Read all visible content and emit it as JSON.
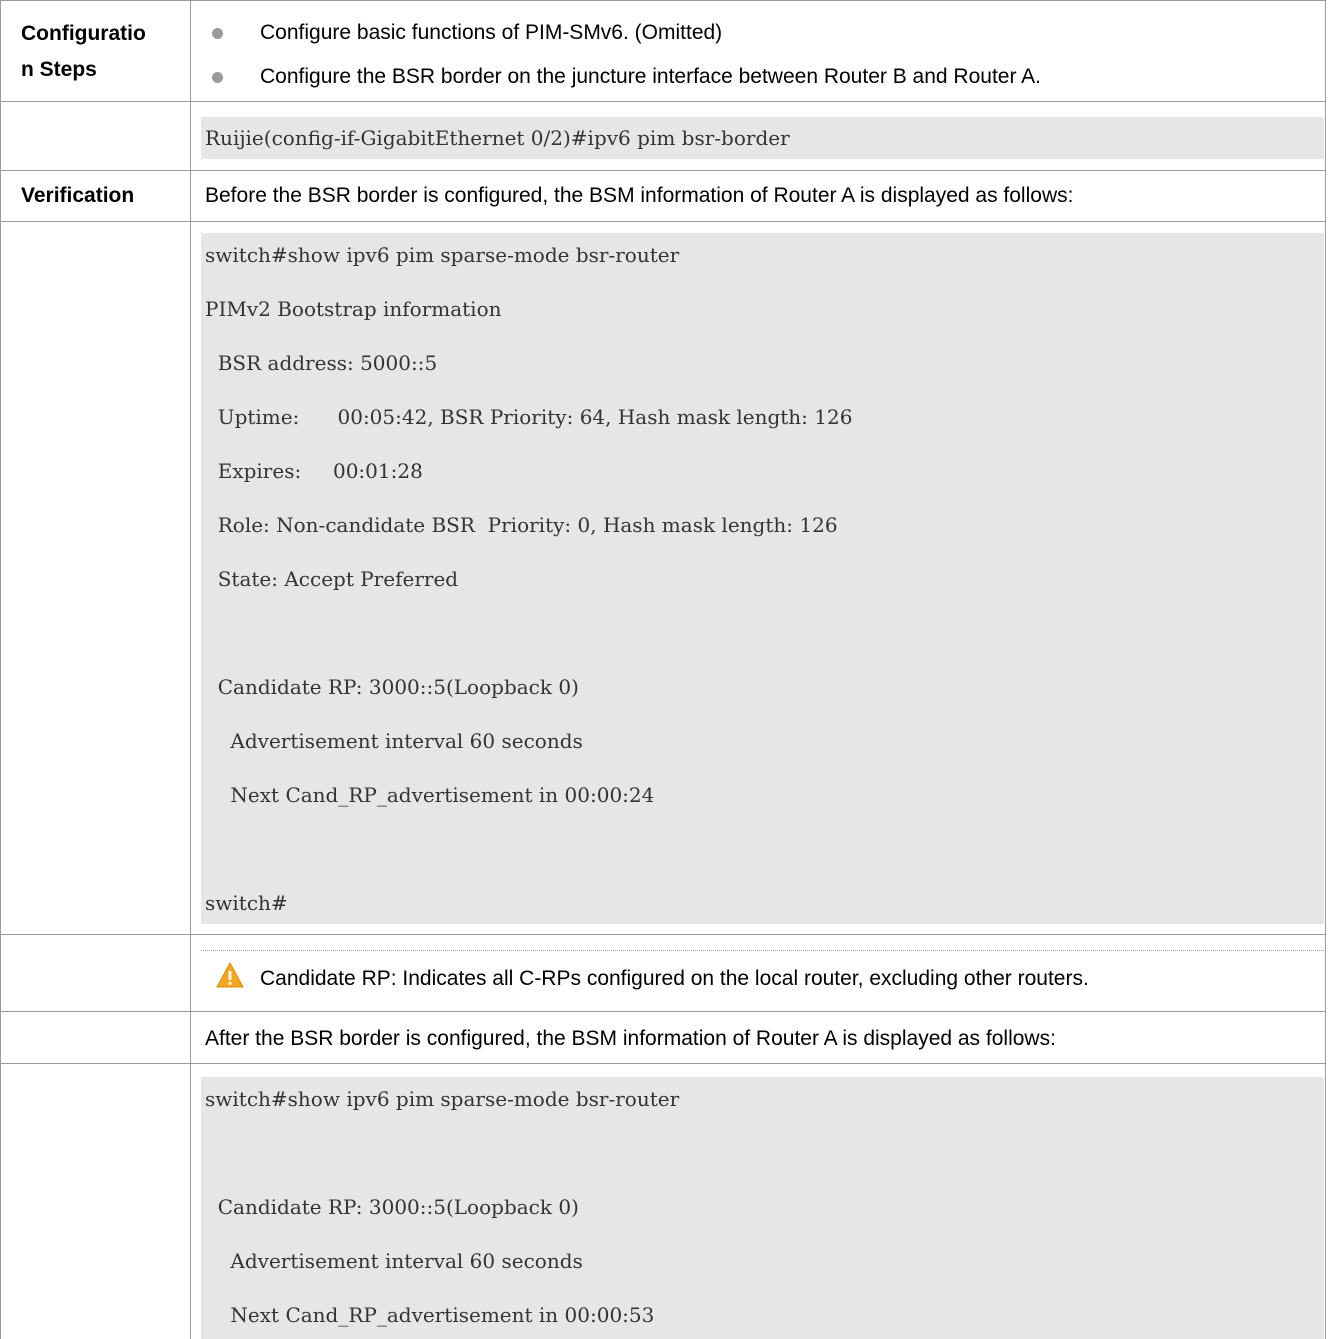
{
  "row1": {
    "label_line1": "Configuratio",
    "label_line2": "n Steps",
    "bullets": [
      "Configure basic functions of PIM-SMv6. (Omitted)",
      "Configure the BSR border on the juncture interface between Router B and Router A."
    ]
  },
  "row2": {
    "code": "Ruijie(config-if-GigabitEthernet 0/2)#ipv6 pim bsr-border"
  },
  "row3": {
    "label": "Verification",
    "text": "Before the BSR border is configured, the BSM information of Router A is displayed as follows:"
  },
  "code_block_1": {
    "lines": [
      "switch#show ipv6 pim sparse-mode bsr-router",
      "PIMv2 Bootstrap information",
      "  BSR address: 5000::5",
      "  Uptime:      00:05:42, BSR Priority: 64, Hash mask length: 126",
      "  Expires:     00:01:28",
      "  Role: Non-candidate BSR  Priority: 0, Hash mask length: 126",
      "  State: Accept Preferred",
      "",
      "  Candidate RP: 3000::5(Loopback 0)",
      "    Advertisement interval 60 seconds",
      "    Next Cand_RP_advertisement in 00:00:24",
      "",
      "switch#"
    ]
  },
  "note": {
    "icon": "warning-icon",
    "text": "Candidate RP: Indicates all C-RPs configured on the local router, excluding other routers."
  },
  "row_after": {
    "text": "After the BSR border is configured, the BSM information of Router A is displayed as follows:"
  },
  "code_block_2": {
    "lines": [
      "switch#show ipv6 pim sparse-mode bsr-router",
      "",
      "  Candidate RP: 3000::5(Loopback 0)",
      "    Advertisement interval 60 seconds",
      "    Next Cand_RP_advertisement in 00:00:53"
    ]
  },
  "colors": {
    "code_bg": "#e6e6e6",
    "border": "#9a9a9a",
    "warning": "#f5a623"
  }
}
